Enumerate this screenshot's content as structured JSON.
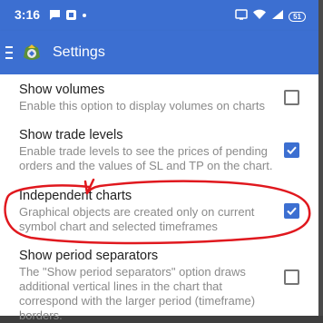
{
  "status_bar": {
    "time": "3:16",
    "battery": "51"
  },
  "app_bar": {
    "title": "Settings"
  },
  "preferences": [
    {
      "title": "Show volumes",
      "summary": "Enable this option to display volumes on charts",
      "checked": false
    },
    {
      "title": "Show trade levels",
      "summary": "Enable trade levels to see the prices of pending orders and the values of SL and TP on the chart.",
      "checked": true
    },
    {
      "title": "Independent charts",
      "summary": "Graphical objects are created only on current symbol chart and selected timeframes",
      "checked": true
    },
    {
      "title": "Show period separators",
      "summary": "The \"Show period separators\" option draws additional vertical lines in the chart that correspond with the larger period (timeframe) borders.",
      "checked": false
    }
  ],
  "colors": {
    "accent": "#3c6fd1",
    "annotation": "#e0181e"
  }
}
